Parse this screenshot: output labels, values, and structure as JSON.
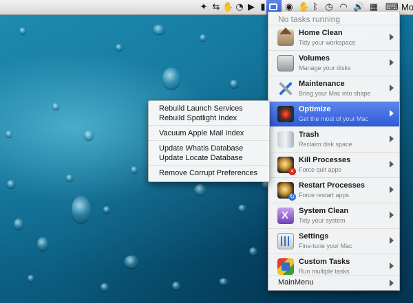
{
  "menubar": {
    "user_name": "Mo",
    "icons": [
      "dropbox-icon",
      "transfer-icon",
      "hand-icon",
      "time-machine-icon",
      "play-icon",
      "battery-icon",
      "app-icon",
      "eye-icon",
      "bluetooth-icon",
      "time-machine-clock-icon",
      "wifi-icon",
      "volume-icon",
      "calendar-icon",
      "keyboard-icon"
    ]
  },
  "main_menu": {
    "status": "No tasks running",
    "items": [
      {
        "title": "Home Clean",
        "subtitle": "Tidy your workspace",
        "icon": "home-icon"
      },
      {
        "title": "Volumes",
        "subtitle": "Manage your disks",
        "icon": "disk-icon"
      },
      {
        "title": "Maintenance",
        "subtitle": "Bring your Mac into shape",
        "icon": "tools-icon"
      },
      {
        "title": "Optimize",
        "subtitle": "Get the most of your Mac",
        "icon": "gauge-icon"
      },
      {
        "title": "Trash",
        "subtitle": "Reclaim disk space",
        "icon": "trash-icon"
      },
      {
        "title": "Kill Processes",
        "subtitle": "Force quit apps",
        "icon": "kill-process-icon"
      },
      {
        "title": "Restart Processes",
        "subtitle": "Force restart apps",
        "icon": "restart-process-icon"
      },
      {
        "title": "System Clean",
        "subtitle": "Tidy your system",
        "icon": "system-clean-icon"
      },
      {
        "title": "Settings",
        "subtitle": "Fine-tune your Mac",
        "icon": "settings-icon"
      },
      {
        "title": "Custom Tasks",
        "subtitle": "Run multiple tasks",
        "icon": "custom-tasks-icon"
      }
    ],
    "footer": "MainMenu",
    "active_item": "Optimize"
  },
  "submenu": {
    "items": [
      "Rebuild Launch Services",
      "Rebuild Spotlight Index",
      "Vacuum Apple Mail Index",
      "Update Whatis Database",
      "Update Locate Database",
      "Remove Corrupt Preferences"
    ]
  },
  "colors": {
    "highlight": "#2e5bd6",
    "wallpaper": "#0b5774"
  }
}
